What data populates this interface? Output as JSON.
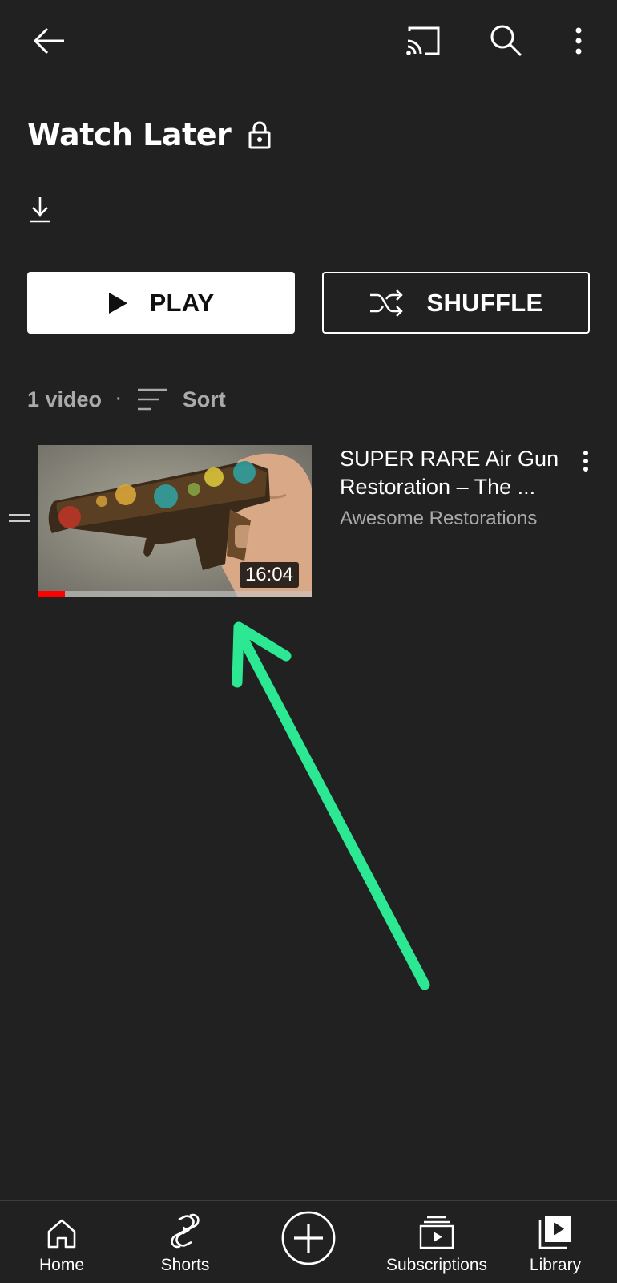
{
  "header": {
    "back_icon": "arrow-left-icon",
    "cast_icon": "cast-icon",
    "search_icon": "search-icon",
    "more_icon": "more-vertical-icon"
  },
  "playlist": {
    "title": "Watch Later",
    "privacy_icon": "lock-icon",
    "download_icon": "download-icon"
  },
  "actions": {
    "play_label": "PLAY",
    "shuffle_label": "SHUFFLE"
  },
  "meta": {
    "count": "1 video",
    "separator": "·",
    "sort_label": "Sort"
  },
  "videos": [
    {
      "title": "SUPER RARE Air Gun\nRestoration – The ...",
      "channel": "Awesome Restorations",
      "duration": "16:04",
      "watched_fraction": 0.1
    }
  ],
  "bottom_nav": [
    {
      "label": "Home",
      "icon": "home-icon"
    },
    {
      "label": "Shorts",
      "icon": "shorts-icon"
    },
    {
      "label": "",
      "icon": "create-plus-icon"
    },
    {
      "label": "Subscriptions",
      "icon": "subscriptions-icon"
    },
    {
      "label": "Library",
      "icon": "library-icon"
    }
  ],
  "colors": {
    "background": "#212121",
    "secondary_text": "#aaaaaa",
    "progress": "#ff0000",
    "annotation_arrow": "#2de893"
  }
}
